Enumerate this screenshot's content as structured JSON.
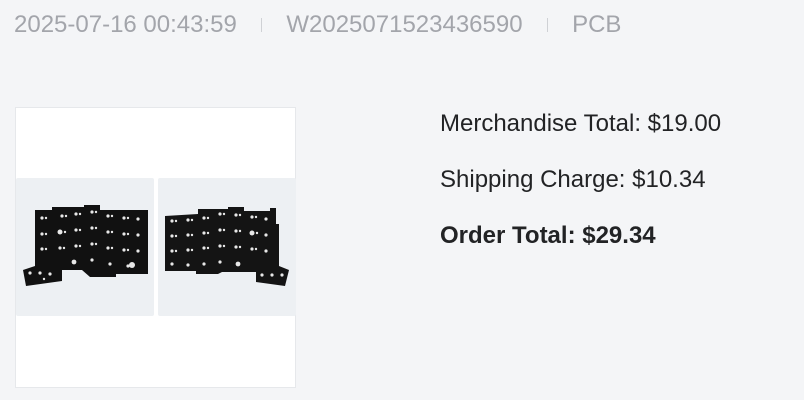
{
  "order_meta": {
    "datetime": "2025-07-16 00:43:59",
    "order_number": "W2025071523436590",
    "category": "PCB"
  },
  "product": {
    "image_icon": "split-keyboard-pcb-image"
  },
  "totals": {
    "merchandise_label": "Merchandise Total: $19.00",
    "shipping_label": "Shipping Charge: $10.34",
    "order_total_label": "Order Total: $29.34"
  },
  "colors": {
    "background": "#f4f5f7",
    "meta_text": "#a3a5ab",
    "body_text": "#222325",
    "pcb": "#101010"
  }
}
